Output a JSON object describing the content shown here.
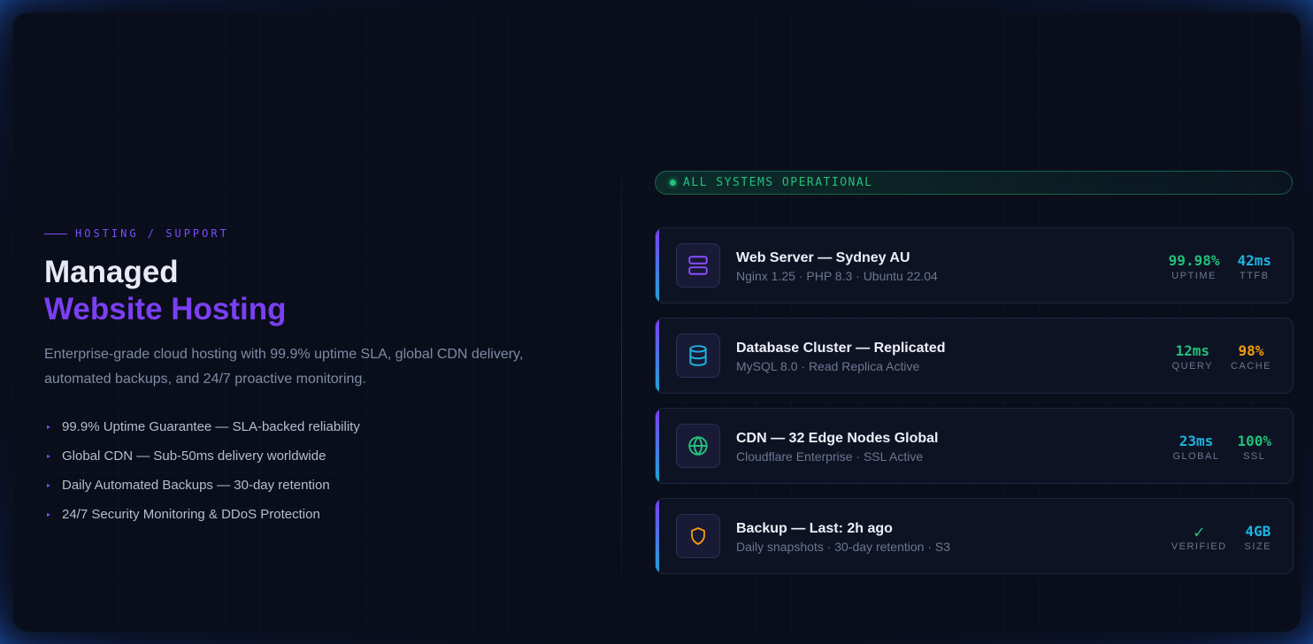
{
  "hero": {
    "eyebrow": "HOSTING / SUPPORT",
    "title_line1": "Managed",
    "title_line2": "Website Hosting",
    "description": "Enterprise-grade cloud hosting with 99.9% uptime SLA, global CDN delivery, automated backups, and 24/7 proactive monitoring.",
    "features": [
      "99.9% Uptime Guarantee — SLA-backed reliability",
      "Global CDN — Sub-50ms delivery worldwide",
      "Daily Automated Backups — 30-day retention",
      "24/7 Security Monitoring & DDoS Protection"
    ],
    "bullet_glyph": "▸"
  },
  "status": {
    "text": "ALL SYSTEMS OPERATIONAL",
    "color": "#22c07a"
  },
  "colors": {
    "accent_purple": "#7b3ff2",
    "green": "#22c07a",
    "cyan": "#1eb3e0",
    "orange": "#f59e0b"
  },
  "cards": [
    {
      "icon": "server-icon",
      "name": "Web Server — Sydney AU",
      "sub": "Nginx 1.25 · PHP 8.3 · Ubuntu 22.04",
      "stats": [
        {
          "value": "99.98%",
          "label": "UPTIME",
          "color": "#22c07a"
        },
        {
          "value": "42ms",
          "label": "TTFB",
          "color": "#1eb3e0"
        }
      ]
    },
    {
      "icon": "database-icon",
      "name": "Database Cluster — Replicated",
      "sub": "MySQL 8.0 · Read Replica Active",
      "stats": [
        {
          "value": "12ms",
          "label": "QUERY",
          "color": "#22c07a"
        },
        {
          "value": "98%",
          "label": "CACHE",
          "color": "#f59e0b"
        }
      ]
    },
    {
      "icon": "globe-icon",
      "name": "CDN — 32 Edge Nodes Global",
      "sub": "Cloudflare Enterprise · SSL Active",
      "stats": [
        {
          "value": "23ms",
          "label": "GLOBAL",
          "color": "#1eb3e0"
        },
        {
          "value": "100%",
          "label": "SSL",
          "color": "#22c07a"
        }
      ]
    },
    {
      "icon": "shield-icon",
      "name": "Backup — Last: 2h ago",
      "sub": "Daily snapshots · 30-day retention · S3",
      "stats": [
        {
          "value": "✓",
          "label": "VERIFIED",
          "color": "#22c07a"
        },
        {
          "value": "4GB",
          "label": "SIZE",
          "color": "#1eb3e0"
        }
      ]
    }
  ]
}
